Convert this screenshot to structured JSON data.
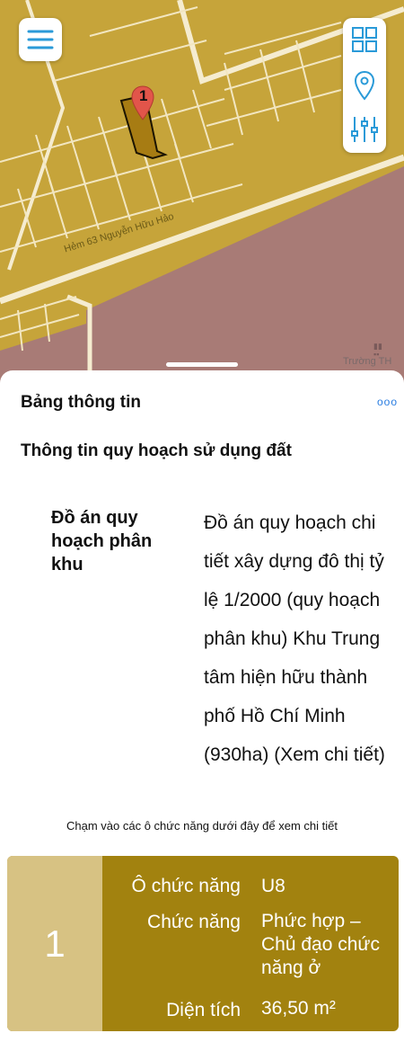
{
  "map": {
    "street_label": "Hẻm 63 Nguyễn Hữu Hảo",
    "poi_label": "Trường TH",
    "marker_number": "1"
  },
  "toolbar": {
    "menu_icon": "hamburger-menu-icon",
    "grid_icon": "grid-icon",
    "location_icon": "map-pin-icon",
    "filter_icon": "sliders-icon"
  },
  "sheet": {
    "title": "Bảng thông tin",
    "more_label": "ooo",
    "section_title": "Thông tin quy hoạch sử dụng đất",
    "plan_label": "Đồ án quy hoạch phân khu",
    "plan_value": "Đồ án quy hoạch chi tiết xây dựng đô thị tỷ lệ 1/2000 (quy hoạch phân khu) Khu Trung tâm hiện hữu thành phố Hồ Chí Minh (930ha) (Xem chi tiết)",
    "hint": "Chạm vào các ô chức năng dưới đây để xem chi tiết"
  },
  "card": {
    "index": "1",
    "rows": [
      {
        "key": "Ô chức năng",
        "value": "U8"
      },
      {
        "key": "Chức năng",
        "value": "Phức hợp – Chủ đạo chức năng ở"
      },
      {
        "key": "Diện tích",
        "value": "36,50 m²"
      }
    ]
  },
  "colors": {
    "residential": "#c6a43a",
    "lot_fill": "#d9bc52",
    "school_zone": "#a87b76",
    "highlight_lot": "#a77c13",
    "card_bg": "#a2820f",
    "card_index_bg": "#d7c283",
    "marker": "#e2554a",
    "accent": "#2a7de1"
  }
}
